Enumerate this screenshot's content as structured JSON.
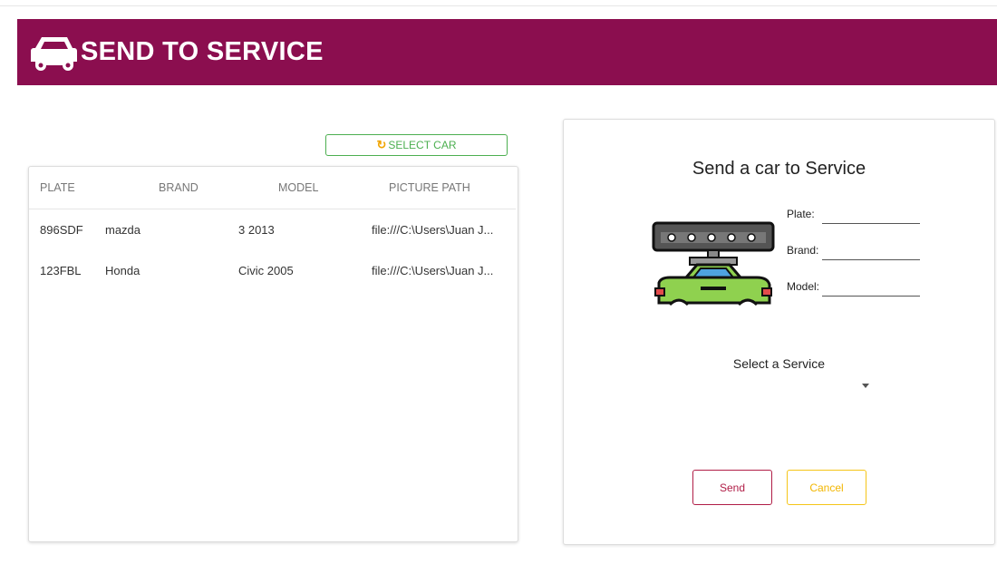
{
  "header": {
    "title": "SEND TO SERVICE"
  },
  "toolbar": {
    "select_car_label": "SELECT CAR"
  },
  "table": {
    "columns": [
      "PLATE",
      "BRAND",
      "MODEL",
      "PICTURE PATH"
    ],
    "rows": [
      {
        "plate": "896SDF",
        "brand": "mazda",
        "model": "3 2013",
        "path": "file:///C:\\Users\\Juan J..."
      },
      {
        "plate": "123FBL",
        "brand": "Honda",
        "model": "Civic 2005",
        "path": "file:///C:\\Users\\Juan J..."
      }
    ]
  },
  "form": {
    "title": "Send a car to Service",
    "plate_label": "Plate:",
    "brand_label": "Brand:",
    "model_label": "Model:",
    "plate_value": "",
    "brand_value": "",
    "model_value": "",
    "service_label": "Select a Service",
    "service_selected": "",
    "send_label": "Send",
    "cancel_label": "Cancel"
  },
  "icons": [
    "car-icon",
    "refresh-icon",
    "car-lift-icon",
    "chevron-down-icon"
  ],
  "colors": {
    "header": "#8b0e4f",
    "select_btn": "#4caf50",
    "send": "#b01d46",
    "cancel": "#f2b600"
  }
}
